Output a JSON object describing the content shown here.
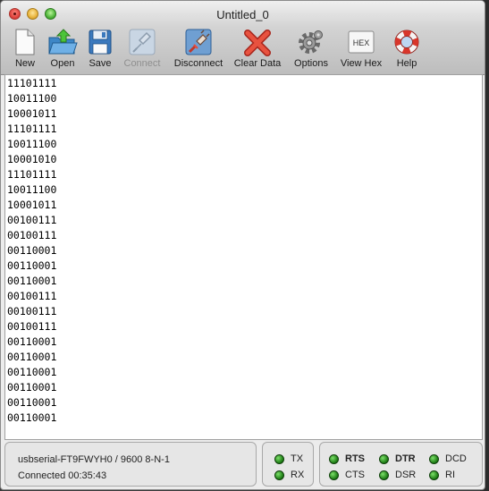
{
  "window": {
    "title": "Untitled_0"
  },
  "toolbar": {
    "new": "New",
    "open": "Open",
    "save": "Save",
    "connect": "Connect",
    "disconnect": "Disconnect",
    "clear_data": "Clear Data",
    "options": "Options",
    "view_hex": "View Hex",
    "hex_badge": "HEX",
    "help": "Help"
  },
  "terminal": {
    "lines": [
      "11101111",
      "10011100",
      "10001011",
      "11101111",
      "10011100",
      "10001010",
      "11101111",
      "10011100",
      "10001011",
      "00100111",
      "00100111",
      "00110001",
      "00110001",
      "00110001",
      "00100111",
      "00100111",
      "00100111",
      "00110001",
      "00110001",
      "00110001",
      "00110001",
      "00110001",
      "00110001"
    ]
  },
  "status": {
    "port": "usbserial-FT9FWYH0 / 9600 8-N-1",
    "connected": "Connected 00:35:43",
    "tx": "TX",
    "rx": "RX",
    "rts": "RTS",
    "cts": "CTS",
    "dtr": "DTR",
    "dsr": "DSR",
    "dcd": "DCD",
    "ri": "RI"
  },
  "colors": {
    "led_on": "#2a9a1e",
    "terminal_bg": "#ffffff"
  }
}
